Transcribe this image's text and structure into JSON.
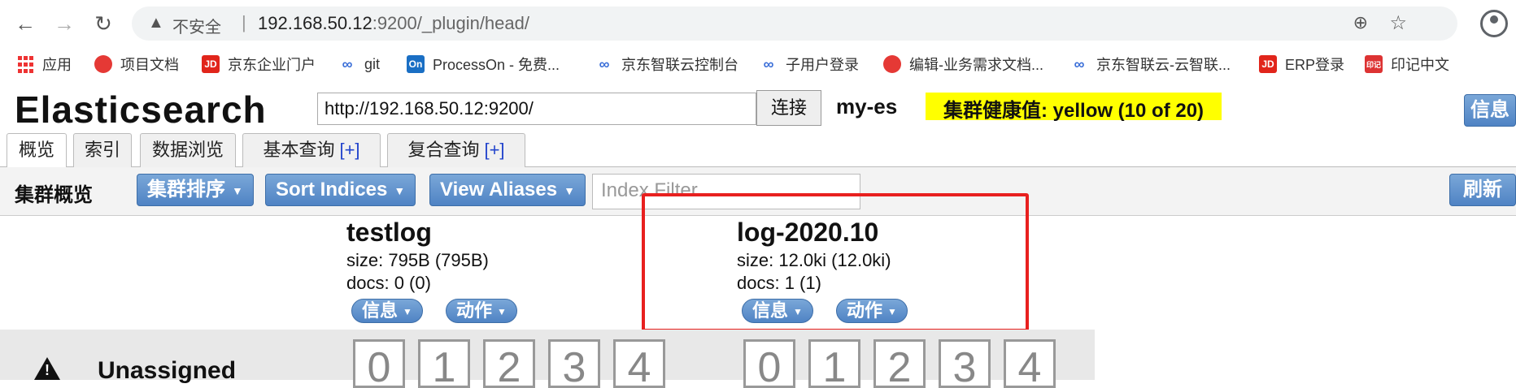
{
  "browser": {
    "security_warning": "不安全",
    "separator": "|",
    "url_host": "192.168.50.12",
    "url_rest": ":9200/_plugin/head/",
    "bookmarks": [
      {
        "label": "应用",
        "icon": "apps-grid-icon"
      },
      {
        "label": "项目文档",
        "icon": "red-circle-icon"
      },
      {
        "label": "京东企业门户",
        "icon": "jd-icon"
      },
      {
        "label": "git",
        "icon": "link-icon"
      },
      {
        "label": "ProcessOn - 免费...",
        "icon": "processon-icon"
      },
      {
        "label": "京东智联云控制台",
        "icon": "link-icon"
      },
      {
        "label": "子用户登录",
        "icon": "link-icon"
      },
      {
        "label": "编辑-业务需求文档...",
        "icon": "red-circle-icon"
      },
      {
        "label": "京东智联云-云智联...",
        "icon": "link-icon"
      },
      {
        "label": "ERP登录",
        "icon": "jd-icon"
      },
      {
        "label": "印记中文",
        "icon": "stamp-icon"
      }
    ],
    "icon_texts": {
      "jd": "JD",
      "on": "On",
      "stamp": "印记"
    }
  },
  "app": {
    "logo": "Elasticsearch",
    "connect_url": "http://192.168.50.12:9200/",
    "connect_button": "连接",
    "cluster_name": "my-es",
    "health": "集群健康值: yellow (10 of 20)",
    "info_button": "信息",
    "tabs": [
      {
        "label": "概览",
        "plus": ""
      },
      {
        "label": "索引",
        "plus": ""
      },
      {
        "label": "数据浏览",
        "plus": ""
      },
      {
        "label": "基本查询",
        "plus": "[+]"
      },
      {
        "label": "复合查询",
        "plus": "[+]"
      }
    ],
    "subbar": {
      "title": "集群概览",
      "sort_cluster": "集群排序",
      "sort_indices": "Sort Indices",
      "view_aliases": "View Aliases",
      "filter_placeholder": "Index Filter",
      "refresh": "刷新"
    },
    "indices": [
      {
        "name": "testlog",
        "size": "size: 795B (795B)",
        "docs": "docs: 0 (0)",
        "info": "信息",
        "action": "动作"
      },
      {
        "name": "log-2020.10",
        "size": "size: 12.0ki (12.0ki)",
        "docs": "docs: 1 (1)",
        "info": "信息",
        "action": "动作"
      }
    ],
    "unassigned": {
      "label": "Unassigned",
      "shards": [
        "0",
        "1",
        "2",
        "3",
        "4"
      ]
    }
  },
  "colors": {
    "health": "#ffff00",
    "highlight": "#e8201f",
    "button": "#4f83c4"
  }
}
